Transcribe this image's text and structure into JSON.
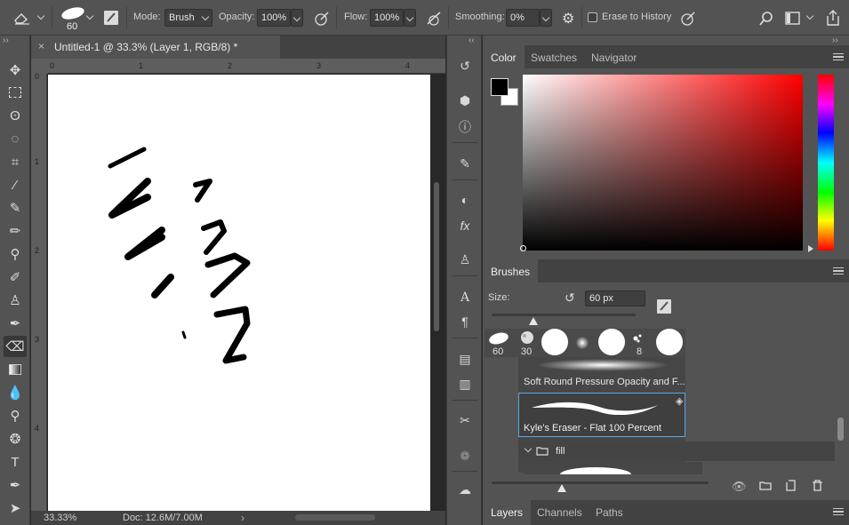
{
  "options_bar": {
    "brush_size": "60",
    "mode_label": "Mode:",
    "mode_value": "Brush",
    "opacity_label": "Opacity:",
    "opacity_value": "100%",
    "flow_label": "Flow:",
    "flow_value": "100%",
    "smoothing_label": "Smoothing:",
    "smoothing_value": "0%",
    "erase_to_history_label": "Erase to History"
  },
  "document": {
    "tab_title": "Untitled-1 @ 33.3% (Layer 1, RGB/8) *",
    "ruler_h_labels": [
      "0",
      "1",
      "2",
      "3",
      "4"
    ],
    "ruler_v_labels": [
      "0",
      "1",
      "2",
      "3",
      "4"
    ],
    "zoom": "33.33%",
    "doc_size": "Doc: 12.6M/7.00M"
  },
  "color_panel": {
    "tabs": [
      "Color",
      "Swatches",
      "Navigator"
    ],
    "active_tab": "Color",
    "foreground": "#000000",
    "background": "#ffffff"
  },
  "brushes_panel": {
    "tab": "Brushes",
    "size_label": "Size:",
    "size_value": "60 px",
    "size_fraction": 0.29,
    "brush_thumbnails": [
      {
        "label": "60"
      },
      {
        "label": "30"
      },
      {
        "label": ""
      },
      {
        "label": ""
      },
      {
        "label": ""
      },
      {
        "label": "8"
      },
      {
        "label": ""
      }
    ],
    "brush_items": [
      "Soft Round Pressure Opacity and F...",
      "Kyle's Eraser - Flat 100 Percent"
    ],
    "selected_brush": "Kyle's Eraser - Flat 100 Percent",
    "folder_name": "fill"
  },
  "layers_panel": {
    "tabs": [
      "Layers",
      "Channels",
      "Paths"
    ],
    "active_tab": "Layers"
  }
}
